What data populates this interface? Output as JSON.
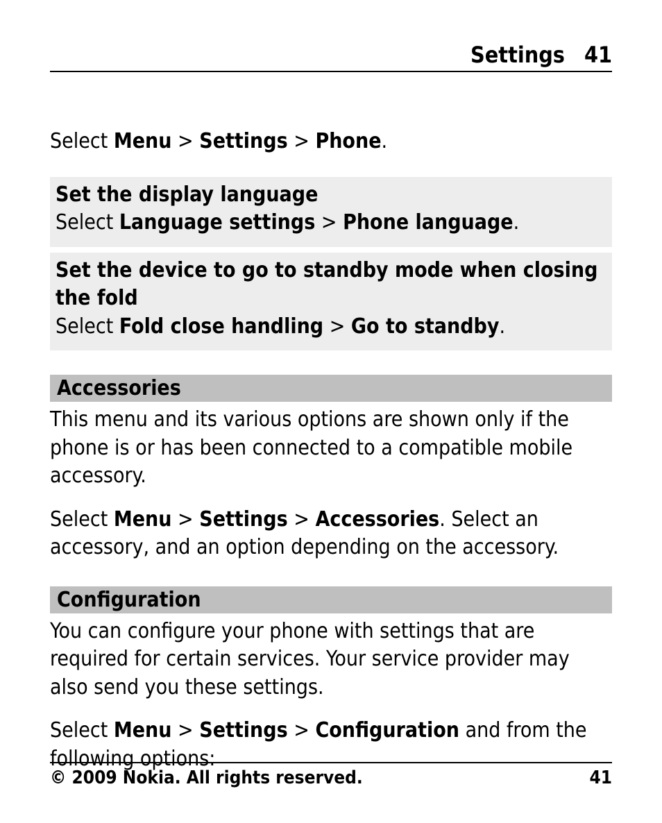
{
  "header": {
    "title": "Settings",
    "page": "41"
  },
  "intro": {
    "pre": "Select ",
    "b1": "Menu",
    "sep1": " > ",
    "b2": "Settings",
    "sep2": " > ",
    "b3": "Phone",
    "tail": "."
  },
  "box1": {
    "title": "Set the display language",
    "pre": "Select ",
    "b1": "Language settings",
    "sep1": " > ",
    "b2": "Phone language",
    "tail": "."
  },
  "box2": {
    "title": "Set the device to go to standby mode when closing the fold",
    "pre": "Select ",
    "b1": "Fold close handling",
    "sep1": " > ",
    "b2": "Go to standby",
    "tail": "."
  },
  "accessories": {
    "heading": "Accessories",
    "p1": "This menu and its various options are shown only if the phone is or has been connected to a compatible mobile accessory.",
    "p2_pre": "Select ",
    "p2_b1": "Menu",
    "p2_sep1": " > ",
    "p2_b2": "Settings",
    "p2_sep2": " > ",
    "p2_b3": "Accessories",
    "p2_tail": ". Select an accessory, and an option depending on the accessory."
  },
  "configuration": {
    "heading": "Configuration",
    "p1": "You can configure your phone with settings that are required for certain services. Your service provider may also send you these settings.",
    "p2_pre": "Select ",
    "p2_b1": "Menu",
    "p2_sep1": " > ",
    "p2_b2": "Settings",
    "p2_sep2": " > ",
    "p2_b3": "Configuration",
    "p2_tail": " and from the following options:"
  },
  "footer": {
    "copyright": "© 2009 Nokia. All rights reserved.",
    "page": "41"
  }
}
